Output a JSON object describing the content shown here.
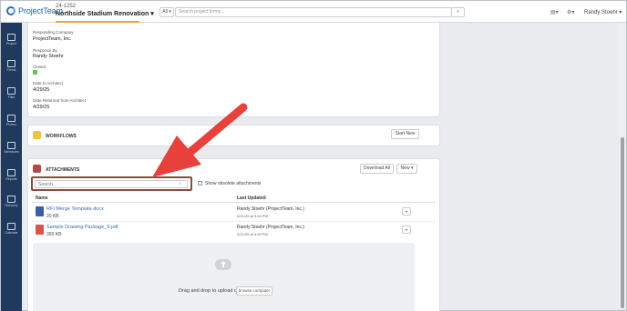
{
  "topbar": {
    "logo_text": "ProjectTeam",
    "project_number": "24-1252",
    "project_name": "Northside Stadium Renovation ▾",
    "filter_label": "All ▾",
    "search_placeholder": "Search project forms...",
    "search_icon_glyph": "⌕",
    "user_name": "Randy Stoehr ▾"
  },
  "sidenav": {
    "items": [
      {
        "label": "Project",
        "icon": "home-icon"
      },
      {
        "label": "Forms",
        "icon": "forms-icon"
      },
      {
        "label": "Files",
        "icon": "folder-icon"
      },
      {
        "label": "Photos",
        "icon": "photos-icon"
      },
      {
        "label": "Schedules",
        "icon": "schedules-icon"
      },
      {
        "label": "Reports",
        "icon": "reports-icon"
      },
      {
        "label": "Directory",
        "icon": "directory-icon"
      },
      {
        "label": "Calendar",
        "icon": "calendar-icon"
      }
    ]
  },
  "details": {
    "responding_company_label": "Responding Company",
    "responding_company_value": "ProjectTeam, Inc.",
    "response_by_label": "Response By",
    "response_by_value": "Randy Stoehr",
    "closed_label": "Closed",
    "closed_checked": true,
    "date_to_architect_label": "Date to Architect",
    "date_to_architect_value": "4/29/25",
    "date_returned_label": "Date Returned from Architect",
    "date_returned_value": "4/29/25"
  },
  "workflows": {
    "title": "WORKFLOWS",
    "start_new_label": "Start New"
  },
  "attachments": {
    "title": "ATTACHMENTS",
    "download_all_label": "Download All",
    "new_label": "New ▾",
    "search_placeholder": "Search...",
    "show_obsolete_label": "Show obsolete attachments",
    "col_name": "Name",
    "col_last_updated": "Last Updated",
    "files": [
      {
        "name": "RFI Merge Template.docx",
        "size": "20 KB",
        "updated_by": "Randy Stoehr (ProjectTeam, Inc.)",
        "updated_at": "5/21/25 at 9:54 PM",
        "type": "doc"
      },
      {
        "name": "Sample Drawing Package_9.pdf",
        "size": "355 KB",
        "updated_by": "Randy Stoehr (ProjectTeam, Inc.)",
        "updated_at": "5/21/25 at 9:09 PM",
        "type": "pdf"
      }
    ],
    "row_action_glyph": "▾",
    "drop_text": "Drag and drop to upload or",
    "browse_label": "browse computer"
  },
  "colors": {
    "nav_bg": "#1f3a5c",
    "accent_orange": "#f2a33a",
    "highlight_box": "#8a4c3e",
    "arrow_red": "#e8403a"
  }
}
